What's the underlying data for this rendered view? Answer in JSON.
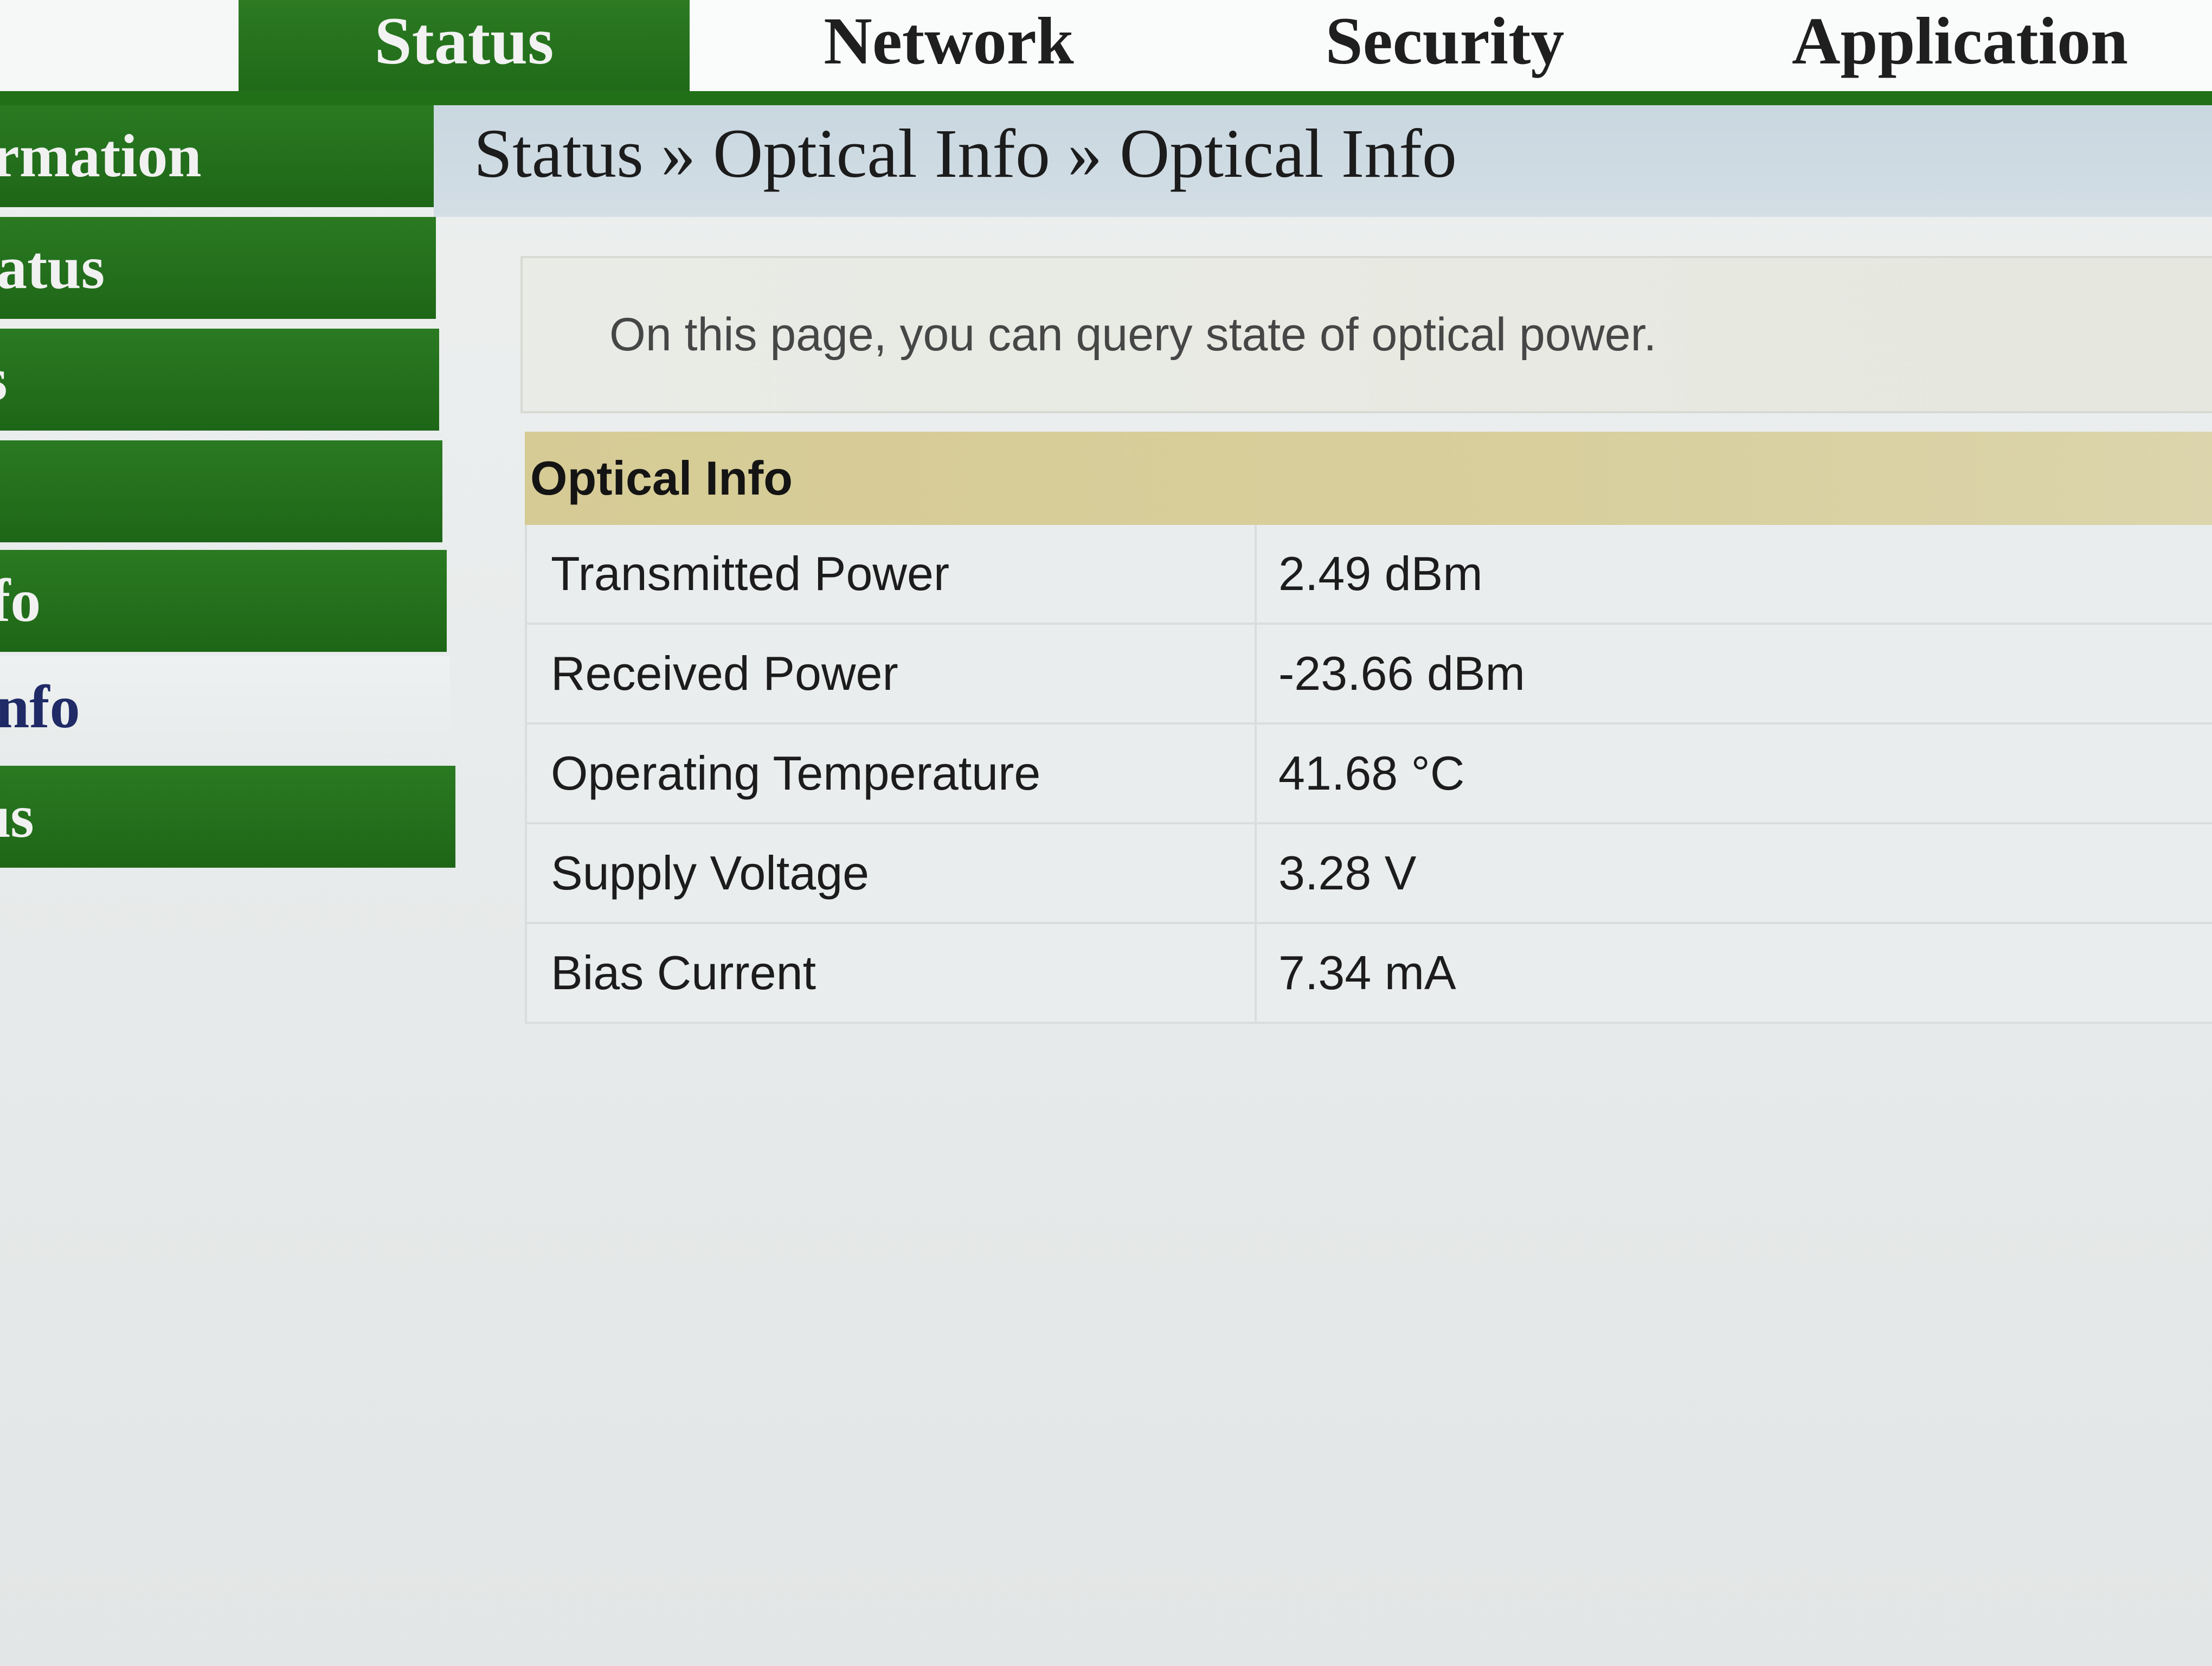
{
  "topnav": {
    "tabs": [
      {
        "label": "Status",
        "active": true
      },
      {
        "label": "Network",
        "active": false
      },
      {
        "label": "Security",
        "active": false
      },
      {
        "label": "Application",
        "active": false
      }
    ]
  },
  "sidebar": {
    "items": [
      {
        "label": "rmation"
      },
      {
        "label": "atus"
      },
      {
        "label": "s"
      },
      {
        "label": ""
      },
      {
        "label": "fo"
      },
      {
        "label": "nfo",
        "current": true
      },
      {
        "label": "ıs"
      }
    ]
  },
  "breadcrumb": {
    "text": "Status » Optical Info » Optical Info"
  },
  "description": {
    "text": "On this page, you can query state of optical power."
  },
  "optical_table": {
    "title": "Optical Info",
    "rows": [
      {
        "label": "Transmitted Power",
        "value": "2.49 dBm"
      },
      {
        "label": "Received Power",
        "value": "-23.66 dBm"
      },
      {
        "label": "Operating Temperature",
        "value": "41.68 °C"
      },
      {
        "label": "Supply Voltage",
        "value": "3.28 V"
      },
      {
        "label": "Bias Current",
        "value": "7.34 mA"
      }
    ]
  },
  "colors": {
    "nav_green": "#217018",
    "breadcrumb_bg": "#cdd9e1",
    "table_header_bg": "#d6cb95"
  }
}
